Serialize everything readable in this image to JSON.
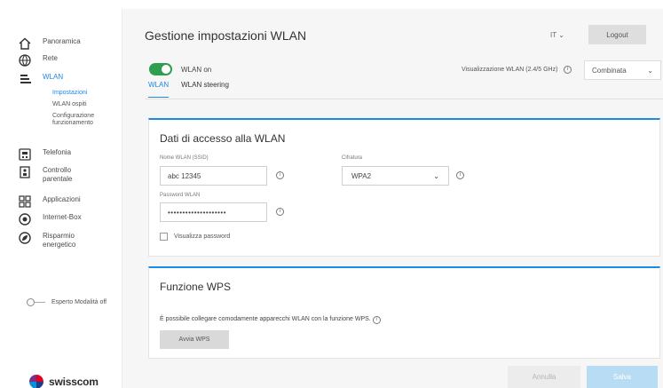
{
  "sidebar": {
    "items": [
      {
        "label": "Panoramica",
        "icon": "home-icon"
      },
      {
        "label": "Rete",
        "icon": "globe-icon"
      },
      {
        "label": "WLAN",
        "icon": "wifi-icon",
        "active": true
      },
      {
        "label": "Telefonia",
        "icon": "phone-icon"
      },
      {
        "label": "Controllo parentale",
        "icon": "parental-icon"
      },
      {
        "label": "Applicazioni",
        "icon": "apps-icon"
      },
      {
        "label": "Internet-Box",
        "icon": "router-icon"
      },
      {
        "label": "Risparmio energetico",
        "icon": "leaf-icon"
      }
    ],
    "wlan_sub": [
      {
        "label": "Impostazioni",
        "active": true
      },
      {
        "label": "WLAN ospiti"
      },
      {
        "label": "Configurazione funzionamento"
      }
    ],
    "expert_label": "Esperto Modalità off"
  },
  "brand": {
    "name": "swisscom",
    "accent": "#1e88e5"
  },
  "header": {
    "title": "Gestione impostazioni WLAN",
    "language": "IT",
    "logout_label": "Logout"
  },
  "wlan": {
    "toggle_label": "WLAN on",
    "view_label": "Visualizzazione WLAN (2.4/5 GHz)",
    "view_value": "Combinata"
  },
  "tabs": [
    {
      "label": "WLAN",
      "active": true
    },
    {
      "label": "WLAN steering"
    }
  ],
  "access": {
    "title": "Dati di accesso alla WLAN",
    "ssid_label": "Nome WLAN (SSID)",
    "ssid_value": "abc 12345",
    "cipher_label": "Cifratura",
    "cipher_value": "WPA2",
    "password_label": "Password WLAN",
    "password_value": "••••••••••••••••••••",
    "show_password_label": "Visualizza password"
  },
  "wps": {
    "title": "Funzione WPS",
    "description": "È possibile collegare comodamente apparecchi WLAN con la funzione WPS.",
    "button_label": "Avvia WPS"
  },
  "footer": {
    "cancel_label": "Annulla",
    "save_label": "Salva"
  }
}
